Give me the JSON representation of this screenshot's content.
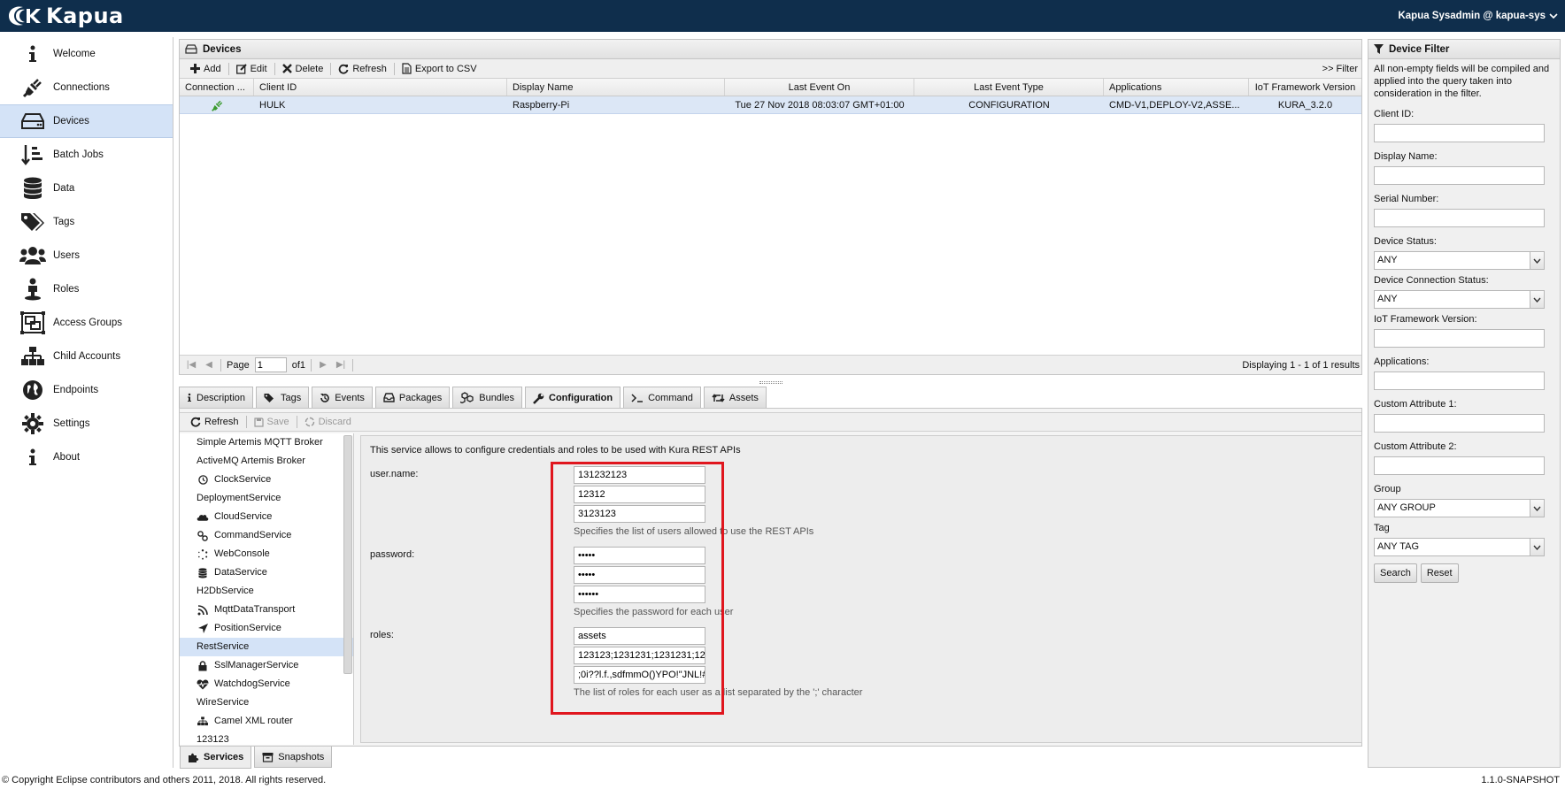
{
  "header": {
    "brand": "Kapua",
    "user": "Kapua Sysadmin @ kapua-sys"
  },
  "nav": [
    {
      "label": "Welcome",
      "icon": "info-icon"
    },
    {
      "label": "Connections",
      "icon": "plug-icon"
    },
    {
      "label": "Devices",
      "icon": "hard-drive-icon"
    },
    {
      "label": "Batch Jobs",
      "icon": "sort-icon"
    },
    {
      "label": "Data",
      "icon": "database-icon"
    },
    {
      "label": "Tags",
      "icon": "tags-icon"
    },
    {
      "label": "Users",
      "icon": "users-icon"
    },
    {
      "label": "Roles",
      "icon": "user-role-icon"
    },
    {
      "label": "Access Groups",
      "icon": "object-group-icon"
    },
    {
      "label": "Child Accounts",
      "icon": "sitemap-icon"
    },
    {
      "label": "Endpoints",
      "icon": "globe-icon"
    },
    {
      "label": "Settings",
      "icon": "gear-icon"
    },
    {
      "label": "About",
      "icon": "info-icon"
    }
  ],
  "devices": {
    "title": "Devices",
    "toolbar": {
      "add": "Add",
      "edit": "Edit",
      "delete": "Delete",
      "refresh": "Refresh",
      "export": "Export to CSV",
      "filter": ">> Filter"
    },
    "columns": [
      "Connection ...",
      "Client ID",
      "Display Name",
      "Last Event On",
      "Last Event Type",
      "Applications",
      "IoT Framework Version"
    ],
    "rows": [
      {
        "client_id": "HULK",
        "display_name": "Raspberry-Pi",
        "last_event_on": "Tue 27 Nov 2018 08:03:07 GMT+01:00",
        "last_event_type": "CONFIGURATION",
        "applications": "CMD-V1,DEPLOY-V2,ASSE...",
        "iot_version": "KURA_3.2.0"
      }
    ],
    "pager": {
      "page_label": "Page",
      "page_value": "1",
      "of_label": "of1",
      "displaying": "Displaying 1 - 1 of 1 results"
    }
  },
  "tabs": [
    {
      "label": "Description",
      "icon": "info-icon"
    },
    {
      "label": "Tags",
      "icon": "tag-icon"
    },
    {
      "label": "Events",
      "icon": "history-icon"
    },
    {
      "label": "Packages",
      "icon": "inbox-icon"
    },
    {
      "label": "Bundles",
      "icon": "cubes-icon"
    },
    {
      "label": "Configuration",
      "icon": "wrench-icon"
    },
    {
      "label": "Command",
      "icon": "terminal-icon"
    },
    {
      "label": "Assets",
      "icon": "retweet-icon"
    }
  ],
  "config_toolbar": {
    "refresh": "Refresh",
    "save": "Save",
    "discard": "Discard"
  },
  "services": [
    {
      "label": "Simple Artemis MQTT Broker",
      "icon": ""
    },
    {
      "label": "ActiveMQ Artemis Broker",
      "icon": ""
    },
    {
      "label": "ClockService",
      "icon": "clock-icon"
    },
    {
      "label": "DeploymentService",
      "icon": ""
    },
    {
      "label": "CloudService",
      "icon": "cloud-icon"
    },
    {
      "label": "CommandService",
      "icon": "link-icon"
    },
    {
      "label": "WebConsole",
      "icon": "spinner-icon"
    },
    {
      "label": "DataService",
      "icon": "database-icon"
    },
    {
      "label": "H2DbService",
      "icon": ""
    },
    {
      "label": "MqttDataTransport",
      "icon": "rss-icon"
    },
    {
      "label": "PositionService",
      "icon": "location-arrow-icon"
    },
    {
      "label": "RestService",
      "icon": ""
    },
    {
      "label": "SslManagerService",
      "icon": "lock-icon"
    },
    {
      "label": "WatchdogService",
      "icon": "heartbeat-icon"
    },
    {
      "label": "WireService",
      "icon": ""
    },
    {
      "label": "Camel XML router",
      "icon": "sitemap-icon"
    },
    {
      "label": "123123",
      "icon": ""
    }
  ],
  "config": {
    "description": "This service allows to configure credentials and roles to be used with Kura REST APIs",
    "username": {
      "label": "user.name:",
      "values": [
        "131232123",
        "12312",
        "3123123"
      ],
      "help": "Specifies the list of users allowed to use the REST APIs"
    },
    "password": {
      "label": "password:",
      "values": [
        "•••••",
        "•••••",
        "••••••"
      ],
      "help": "Specifies the password for each user"
    },
    "roles": {
      "label": "roles:",
      "values": [
        "assets",
        "123123;1231231;1231231;12",
        ";0i??l.f.,sdfmmO()YPO!\"JNL!#"
      ],
      "help": "The list of roles for each user as a list separated by the ';' character"
    }
  },
  "bottom_tabs": [
    {
      "label": "Services",
      "icon": "puzzle-icon"
    },
    {
      "label": "Snapshots",
      "icon": "archive-icon"
    }
  ],
  "filter": {
    "title": "Device Filter",
    "note": "All non-empty fields will be compiled and applied into the query taken into consideration in the filter.",
    "client_id": "Client ID:",
    "display_name": "Display Name:",
    "serial_number": "Serial Number:",
    "device_status": "Device Status:",
    "device_status_value": "ANY",
    "connection_status": "Device Connection Status:",
    "connection_status_value": "ANY",
    "iot_version": "IoT Framework Version:",
    "applications": "Applications:",
    "custom1": "Custom Attribute 1:",
    "custom2": "Custom Attribute 2:",
    "group": "Group",
    "group_value": "ANY GROUP",
    "tag": "Tag",
    "tag_value": "ANY TAG",
    "search": "Search",
    "reset": "Reset"
  },
  "footer": {
    "copyright": "© Copyright Eclipse contributors and others 2011, 2018. All rights reserved.",
    "version": "1.1.0-SNAPSHOT"
  },
  "colors": {
    "header_bg": "#0f2e4c",
    "selection": "#d4e3f7",
    "highlight": "#e0161e"
  }
}
